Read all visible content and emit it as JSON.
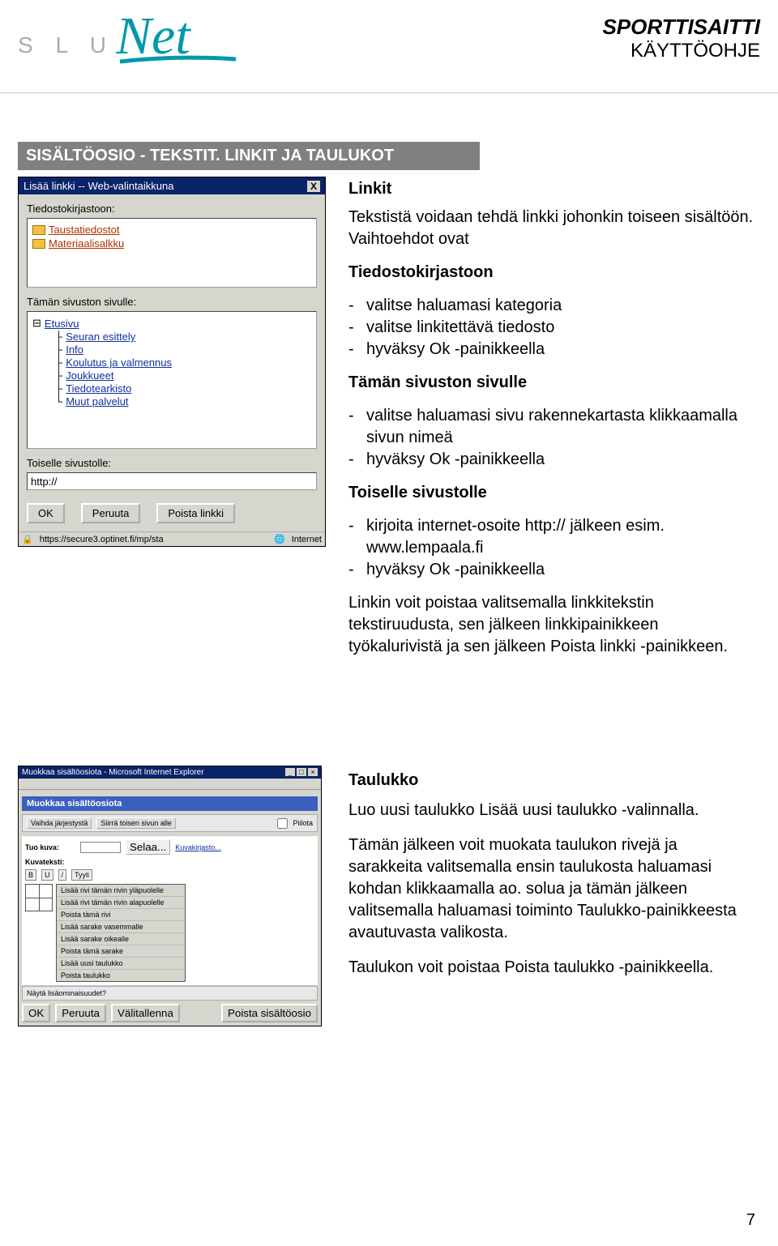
{
  "header": {
    "logo_slu": "S L U",
    "title": "SPORTTISAITTI",
    "subtitle": "KÄYTTÖOHJE"
  },
  "section_heading": "SISÄLTÖOSIO - TEKSTIT. LINKIT JA TAULUKOT",
  "dialog1": {
    "title": "Lisää linkki -- Web-valintaikkuna",
    "label_filestore": "Tiedostokirjastoon:",
    "files": [
      "Taustatiedostot",
      "Materiaalisalkku"
    ],
    "label_thissite": "Tämän sivuston sivulle:",
    "tree": [
      "Etusivu",
      "Seuran esittely",
      "Info",
      "Koulutus ja valmennus",
      "Joukkueet",
      "Tiedotearkisto",
      "Muut palvelut"
    ],
    "label_othersite": "Toiselle sivustolle:",
    "http_value": "http://",
    "btn_ok": "OK",
    "btn_cancel": "Peruuta",
    "btn_removelink": "Poista linkki",
    "status_url": "https://secure3.optinet.fi/mp/sta",
    "status_zone": "Internet"
  },
  "content1": {
    "h_linkit": "Linkit",
    "p_intro": "Tekstistä voidaan tehdä linkki johonkin toiseen sisältöön. Vaihtoehdot ovat",
    "h_tiedosto": "Tiedostokirjastoon",
    "li_tiedosto": [
      "valitse haluamasi kategoria",
      "valitse linkitettävä tiedosto",
      "hyväksy Ok -painikkeella"
    ],
    "h_taman": "Tämän sivuston sivulle",
    "li_taman": [
      "valitse haluamasi sivu rakennekartasta klikkaamalla sivun nimeä",
      "hyväksy Ok -painikkeella"
    ],
    "h_toiselle": "Toiselle sivustolle",
    "li_toiselle": [
      "kirjoita internet-osoite http:// jälkeen esim. www.lempaala.fi",
      "hyväksy Ok -painikkeella"
    ],
    "p_remove": "Linkin voit poistaa valitsemalla linkkitekstin tekstiruudusta, sen jälkeen linkkipainikkeen työkalurivistä ja sen jälkeen Poista linkki -painikkeen."
  },
  "dialog2": {
    "title": "Muokkaa sisältöosiota - Microsoft Internet Explorer",
    "bluebar": "Muokkaa sisältöosiota",
    "strip": {
      "tab1": "Vaihda järjestystä",
      "tab2": "Siirrä toisen sivun alle",
      "chk": "Piilota"
    },
    "row_image": {
      "label": "Tuo kuva:",
      "btn": "Selaa...",
      "link": "Kuvakirjasto..."
    },
    "row_text": {
      "label": "Kuvateksti:"
    },
    "toolbar": [
      "B",
      "U",
      "/",
      "Tyyli"
    ],
    "menu": [
      "Lisää rivi tämän rivin yläpuolelle",
      "Lisää rivi tämän rivin alapuolelle",
      "Poista tämä rivi",
      "Lisää sarake vasemmalle",
      "Lisää sarake oikealle",
      "Poista tämä sarake",
      "Lisää uusi taulukko",
      "Poista taulukko"
    ],
    "show_more": "Näytä lisäominaisuudet?",
    "btn_ok": "OK",
    "btn_cancel": "Peruuta",
    "btn_save": "Välitallenna",
    "btn_delete": "Poista sisältöosio"
  },
  "content2": {
    "h": "Taulukko",
    "p1": "Luo uusi taulukko Lisää uusi taulukko -valinnalla.",
    "p2": "Tämän jälkeen voit muokata taulukon rivejä ja sarakkeita valitsemalla ensin taulukosta haluamasi kohdan klikkaamalla ao. solua ja tämän jälkeen valitsemalla haluamasi toiminto Taulukko-painikkeesta avautuvasta valikosta.",
    "p3": "Taulukon voit poistaa Poista taulukko -painikkeella."
  },
  "page_number": "7"
}
